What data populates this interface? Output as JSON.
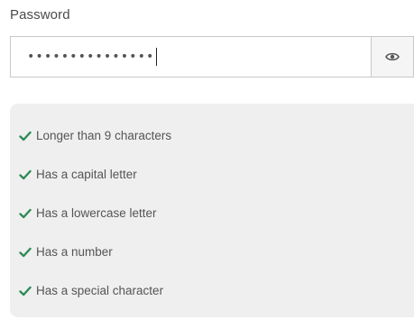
{
  "password_field": {
    "label": "Password",
    "masked_value": "•••••••••••••••",
    "toggle_icon": "eye-icon"
  },
  "requirements": {
    "check_color": "#2e8b57",
    "items": [
      {
        "label": "Longer than 9 characters",
        "met": true
      },
      {
        "label": "Has a capital letter",
        "met": true
      },
      {
        "label": "Has a lowercase letter",
        "met": true
      },
      {
        "label": "Has a number",
        "met": true
      },
      {
        "label": "Has a special character",
        "met": true
      }
    ]
  }
}
